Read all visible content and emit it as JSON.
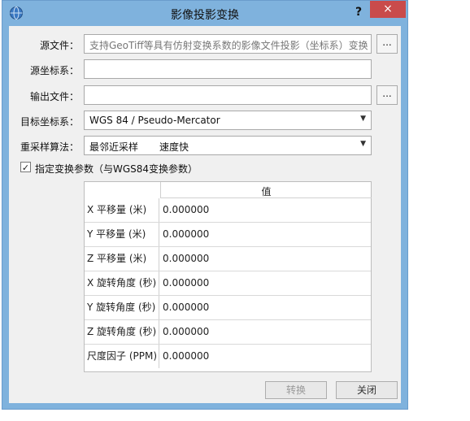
{
  "window": {
    "title": "影像投影变换",
    "help": "?",
    "close": "×"
  },
  "form": {
    "source_file": {
      "label": "源文件：",
      "placeholder": "支持GeoTiff等具有仿射变换系数的影像文件投影（坐标系）变换",
      "browse": "..."
    },
    "source_crs": {
      "label": "源坐标系：",
      "value": ""
    },
    "output_file": {
      "label": "输出文件：",
      "value": "",
      "browse": "..."
    },
    "target_crs": {
      "label": "目标坐标系：",
      "value": "WGS 84 / Pseudo-Mercator"
    },
    "resample": {
      "label": "重采样算法：",
      "value": "最邻近采样",
      "desc": "速度快"
    }
  },
  "specify_params": {
    "label": "指定变换参数（与WGS84变换参数）",
    "checked": true,
    "mark": "✓"
  },
  "params_table": {
    "column_header": "值",
    "rows": [
      {
        "name": "X 平移量 (米)",
        "value": "0.000000"
      },
      {
        "name": "Y 平移量 (米)",
        "value": "0.000000"
      },
      {
        "name": "Z 平移量 (米)",
        "value": "0.000000"
      },
      {
        "name": "X 旋转角度 (秒)",
        "value": "0.000000"
      },
      {
        "name": "Y 旋转角度 (秒)",
        "value": "0.000000"
      },
      {
        "name": "Z 旋转角度 (秒)",
        "value": "0.000000"
      },
      {
        "name": "尺度因子 (PPM)",
        "value": "0.000000"
      }
    ]
  },
  "buttons": {
    "convert": "转换",
    "close": "关闭"
  }
}
